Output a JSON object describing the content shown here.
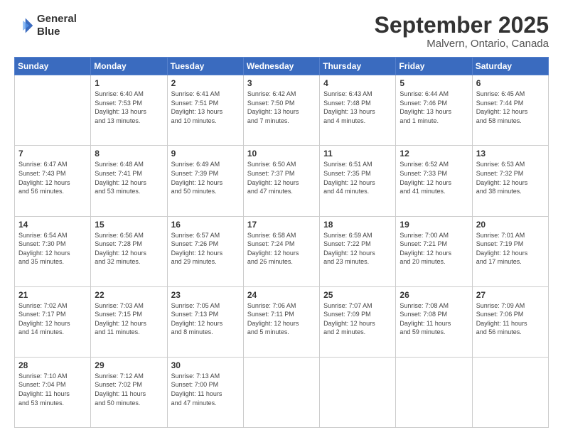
{
  "header": {
    "logo_line1": "General",
    "logo_line2": "Blue",
    "month": "September 2025",
    "location": "Malvern, Ontario, Canada"
  },
  "weekdays": [
    "Sunday",
    "Monday",
    "Tuesday",
    "Wednesday",
    "Thursday",
    "Friday",
    "Saturday"
  ],
  "weeks": [
    [
      {
        "day": "",
        "info": ""
      },
      {
        "day": "1",
        "info": "Sunrise: 6:40 AM\nSunset: 7:53 PM\nDaylight: 13 hours\nand 13 minutes."
      },
      {
        "day": "2",
        "info": "Sunrise: 6:41 AM\nSunset: 7:51 PM\nDaylight: 13 hours\nand 10 minutes."
      },
      {
        "day": "3",
        "info": "Sunrise: 6:42 AM\nSunset: 7:50 PM\nDaylight: 13 hours\nand 7 minutes."
      },
      {
        "day": "4",
        "info": "Sunrise: 6:43 AM\nSunset: 7:48 PM\nDaylight: 13 hours\nand 4 minutes."
      },
      {
        "day": "5",
        "info": "Sunrise: 6:44 AM\nSunset: 7:46 PM\nDaylight: 13 hours\nand 1 minute."
      },
      {
        "day": "6",
        "info": "Sunrise: 6:45 AM\nSunset: 7:44 PM\nDaylight: 12 hours\nand 58 minutes."
      }
    ],
    [
      {
        "day": "7",
        "info": "Sunrise: 6:47 AM\nSunset: 7:43 PM\nDaylight: 12 hours\nand 56 minutes."
      },
      {
        "day": "8",
        "info": "Sunrise: 6:48 AM\nSunset: 7:41 PM\nDaylight: 12 hours\nand 53 minutes."
      },
      {
        "day": "9",
        "info": "Sunrise: 6:49 AM\nSunset: 7:39 PM\nDaylight: 12 hours\nand 50 minutes."
      },
      {
        "day": "10",
        "info": "Sunrise: 6:50 AM\nSunset: 7:37 PM\nDaylight: 12 hours\nand 47 minutes."
      },
      {
        "day": "11",
        "info": "Sunrise: 6:51 AM\nSunset: 7:35 PM\nDaylight: 12 hours\nand 44 minutes."
      },
      {
        "day": "12",
        "info": "Sunrise: 6:52 AM\nSunset: 7:33 PM\nDaylight: 12 hours\nand 41 minutes."
      },
      {
        "day": "13",
        "info": "Sunrise: 6:53 AM\nSunset: 7:32 PM\nDaylight: 12 hours\nand 38 minutes."
      }
    ],
    [
      {
        "day": "14",
        "info": "Sunrise: 6:54 AM\nSunset: 7:30 PM\nDaylight: 12 hours\nand 35 minutes."
      },
      {
        "day": "15",
        "info": "Sunrise: 6:56 AM\nSunset: 7:28 PM\nDaylight: 12 hours\nand 32 minutes."
      },
      {
        "day": "16",
        "info": "Sunrise: 6:57 AM\nSunset: 7:26 PM\nDaylight: 12 hours\nand 29 minutes."
      },
      {
        "day": "17",
        "info": "Sunrise: 6:58 AM\nSunset: 7:24 PM\nDaylight: 12 hours\nand 26 minutes."
      },
      {
        "day": "18",
        "info": "Sunrise: 6:59 AM\nSunset: 7:22 PM\nDaylight: 12 hours\nand 23 minutes."
      },
      {
        "day": "19",
        "info": "Sunrise: 7:00 AM\nSunset: 7:21 PM\nDaylight: 12 hours\nand 20 minutes."
      },
      {
        "day": "20",
        "info": "Sunrise: 7:01 AM\nSunset: 7:19 PM\nDaylight: 12 hours\nand 17 minutes."
      }
    ],
    [
      {
        "day": "21",
        "info": "Sunrise: 7:02 AM\nSunset: 7:17 PM\nDaylight: 12 hours\nand 14 minutes."
      },
      {
        "day": "22",
        "info": "Sunrise: 7:03 AM\nSunset: 7:15 PM\nDaylight: 12 hours\nand 11 minutes."
      },
      {
        "day": "23",
        "info": "Sunrise: 7:05 AM\nSunset: 7:13 PM\nDaylight: 12 hours\nand 8 minutes."
      },
      {
        "day": "24",
        "info": "Sunrise: 7:06 AM\nSunset: 7:11 PM\nDaylight: 12 hours\nand 5 minutes."
      },
      {
        "day": "25",
        "info": "Sunrise: 7:07 AM\nSunset: 7:09 PM\nDaylight: 12 hours\nand 2 minutes."
      },
      {
        "day": "26",
        "info": "Sunrise: 7:08 AM\nSunset: 7:08 PM\nDaylight: 11 hours\nand 59 minutes."
      },
      {
        "day": "27",
        "info": "Sunrise: 7:09 AM\nSunset: 7:06 PM\nDaylight: 11 hours\nand 56 minutes."
      }
    ],
    [
      {
        "day": "28",
        "info": "Sunrise: 7:10 AM\nSunset: 7:04 PM\nDaylight: 11 hours\nand 53 minutes."
      },
      {
        "day": "29",
        "info": "Sunrise: 7:12 AM\nSunset: 7:02 PM\nDaylight: 11 hours\nand 50 minutes."
      },
      {
        "day": "30",
        "info": "Sunrise: 7:13 AM\nSunset: 7:00 PM\nDaylight: 11 hours\nand 47 minutes."
      },
      {
        "day": "",
        "info": ""
      },
      {
        "day": "",
        "info": ""
      },
      {
        "day": "",
        "info": ""
      },
      {
        "day": "",
        "info": ""
      }
    ]
  ]
}
